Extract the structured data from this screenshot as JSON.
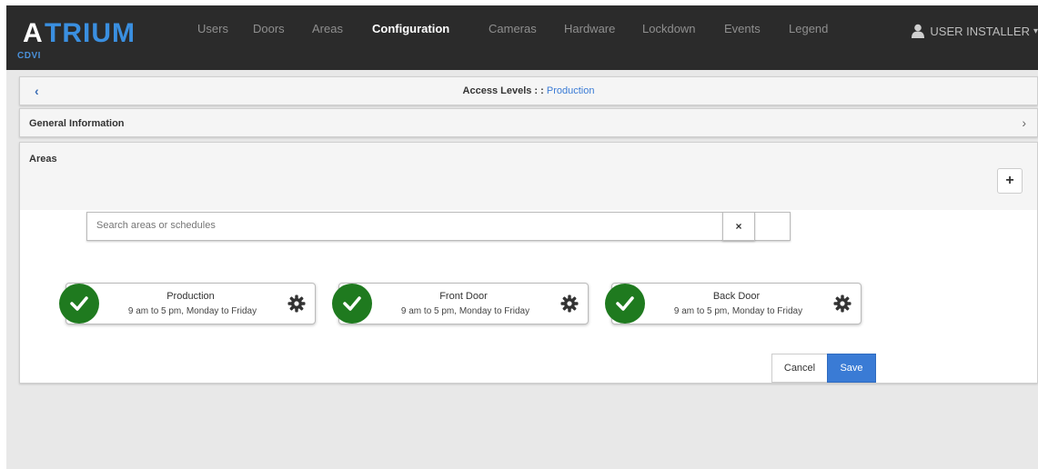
{
  "brand": {
    "name": "ATRIUM",
    "sub": "CDVI"
  },
  "nav": {
    "items": [
      "Users",
      "Doors",
      "Areas",
      "Configuration",
      "Cameras",
      "Hardware",
      "Lockdown",
      "Events",
      "Legend"
    ],
    "active": "Configuration"
  },
  "user": {
    "label": "USER INSTALLER"
  },
  "breadcrumb": {
    "prefix": "Access Levels : : ",
    "current": "Production"
  },
  "general": {
    "title": "General Information"
  },
  "areas": {
    "title": "Areas",
    "search_placeholder": "Search areas or schedules",
    "clear_label": "×",
    "add_label": "+",
    "cards": [
      {
        "name": "Production",
        "schedule": "9 am to 5 pm, Monday to Friday"
      },
      {
        "name": "Front Door",
        "schedule": "9 am to 5 pm, Monday to Friday"
      },
      {
        "name": "Back Door",
        "schedule": "9 am to 5 pm, Monday to Friday"
      }
    ]
  },
  "actions": {
    "cancel": "Cancel",
    "save": "Save"
  },
  "colors": {
    "topbar": "#2b2b2b",
    "accent": "#3a7bd5",
    "check": "#1f7a1f"
  }
}
